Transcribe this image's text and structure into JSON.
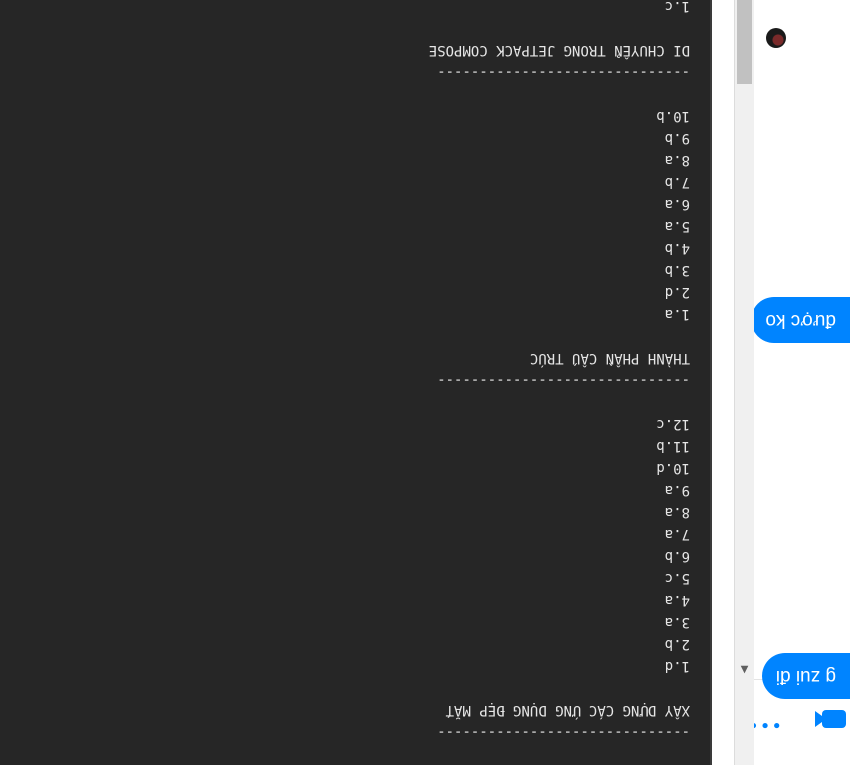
{
  "editor": {
    "lines": [
      {
        "text": "1.c"
      },
      {
        "text": "DI CHUYỂN TRONG JETPACK COMPOSE"
      },
      {
        "text": "------------------------------"
      },
      {
        "text": "10.b"
      },
      {
        "text": "9.b"
      },
      {
        "text": "8.a"
      },
      {
        "text": "7.b"
      },
      {
        "text": "6.a"
      },
      {
        "text": "5.a"
      },
      {
        "text": "4.b"
      },
      {
        "text": "3.b"
      },
      {
        "text": "2.d"
      },
      {
        "text": "1.a"
      },
      {
        "text": "THÀNH PHẦN CẤU TRÚC"
      },
      {
        "text": "------------------------------"
      },
      {
        "text": "12.c"
      },
      {
        "text": "11.b"
      },
      {
        "text": "10.d"
      },
      {
        "text": "9.a"
      },
      {
        "text": "8.a"
      },
      {
        "text": "7.a"
      },
      {
        "text": "6.b"
      },
      {
        "text": "5.c"
      },
      {
        "text": "4.a"
      },
      {
        "text": "3.a"
      },
      {
        "text": "2.b"
      },
      {
        "text": "1.d"
      },
      {
        "text": "XÂY DỰNG CÁC ỨNG DỤNG ĐẸP MẮT"
      },
      {
        "text": "------------------------------"
      }
    ]
  },
  "chat": {
    "messages": [
      {
        "text": "được ko"
      },
      {
        "text": "g zui đi"
      }
    ],
    "icons": {
      "avatar": "avatar",
      "more": "more-icon",
      "video": "video-call-icon"
    },
    "accent": "#0084ff"
  },
  "orientation": "rotated-180"
}
